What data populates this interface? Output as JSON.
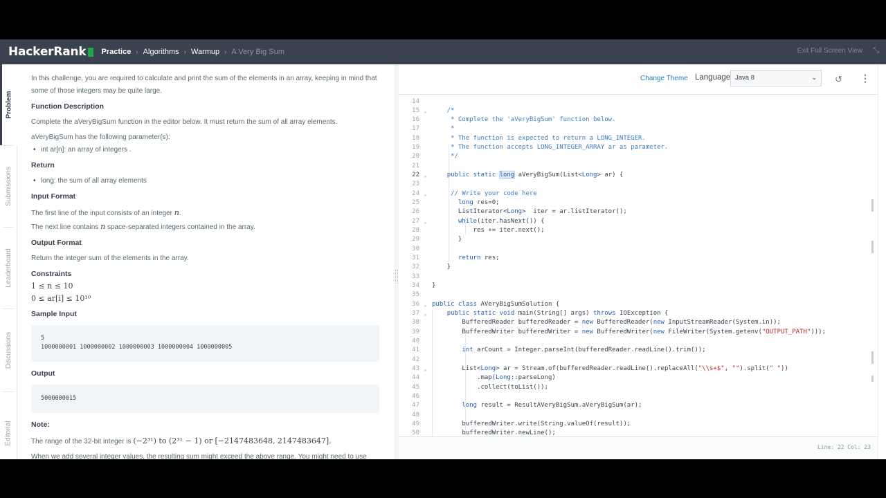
{
  "navbar": {
    "logo": "HackerRank",
    "breadcrumbs": [
      "Practice",
      "Algorithms",
      "Warmup",
      "A Very Big Sum"
    ],
    "exit_label": "Exit Full Screen View"
  },
  "vtabs": [
    "Problem",
    "Submissions",
    "Leaderboard",
    "Discussions",
    "Editorial"
  ],
  "problem": {
    "intro": "In this challenge, you are required to calculate and print the sum of the elements in an array, keeping in mind that some of those integers may be quite large.",
    "fd_heading": "Function Description",
    "fd_text": "Complete the aVeryBigSum function in the editor below. It must return the sum of all array elements.",
    "params_text": "aVeryBigSum has the following parameter(s):",
    "param_item": "int ar[n]: an array of integers .",
    "return_heading": "Return",
    "return_item": "long: the sum of all array elements",
    "input_heading": "Input Format",
    "input_line1": "The first line of the input consists of an integer",
    "input_line1_var": "n",
    "input_line2a": "The next line contains",
    "input_line2_var": "n",
    "input_line2b": "space-separated integers contained in the array.",
    "output_heading": "Output Format",
    "output_text": "Return the integer sum of the elements in the array.",
    "constraints_heading": "Constraints",
    "constraint1": "1 ≤ n ≤ 10",
    "constraint2": "0 ≤ ar[i] ≤ 10¹⁰",
    "sample_input_heading": "Sample Input",
    "sample_input_line1": "5",
    "sample_input_line2": "1000000001 1000000002 1000000003 1000000004 1000000005",
    "output_label": "Output",
    "sample_output": "5000000015",
    "note_heading": "Note:",
    "note_text_a": "The range of the 32-bit integer is",
    "note_math": "(−2³¹) to (2³¹ − 1) or [−2147483648, 2147483647].",
    "note_text2": "When we add several integer values, the resulting sum might exceed the above range. You might need to use long int C/C++/Java to store such sums."
  },
  "editor": {
    "change_theme": "Change Theme",
    "language_label": "Language",
    "language_value": "Java 8",
    "status": "Line: 22 Col: 23"
  }
}
